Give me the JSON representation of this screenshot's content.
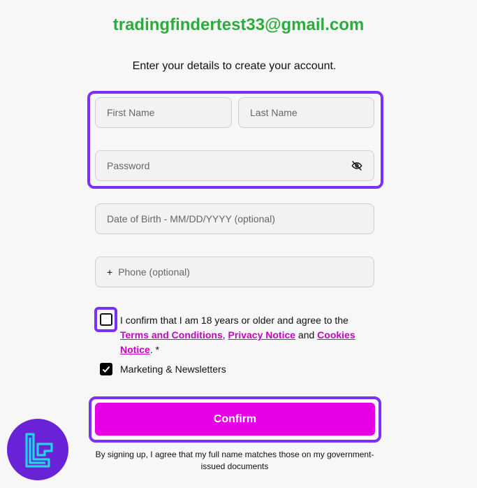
{
  "header": {
    "email": "tradingfindertest33@gmail.com",
    "subtitle": "Enter your details to create your account."
  },
  "form": {
    "first_name": {
      "placeholder": "First Name",
      "value": ""
    },
    "last_name": {
      "placeholder": "Last Name",
      "value": ""
    },
    "password": {
      "placeholder": "Password",
      "value": "",
      "icon": "eye-off-icon"
    },
    "dob": {
      "placeholder": "Date of Birth - MM/DD/YYYY (optional)",
      "value": ""
    },
    "phone": {
      "prefix": "+",
      "placeholder": "Phone (optional)",
      "value": ""
    }
  },
  "consent": {
    "checked": false,
    "text_before": "I confirm that I am 18 years or older and agree to the ",
    "terms_link": "Terms and Conditions",
    "sep1": ", ",
    "privacy_link": "Privacy Notice",
    "sep2": " and ",
    "cookies_link": "Cookies Notice",
    "text_after": ". *"
  },
  "marketing": {
    "checked": true,
    "label": "Marketing & Newsletters"
  },
  "confirm_button": {
    "label": "Confirm"
  },
  "disclaimer": "By signing up, I agree that my full name matches those on my government-issued documents",
  "colors": {
    "email_green": "#2eab3d",
    "accent_purple": "#7b2ff7",
    "link_magenta": "#c800c8",
    "button_magenta": "#e600e6"
  }
}
